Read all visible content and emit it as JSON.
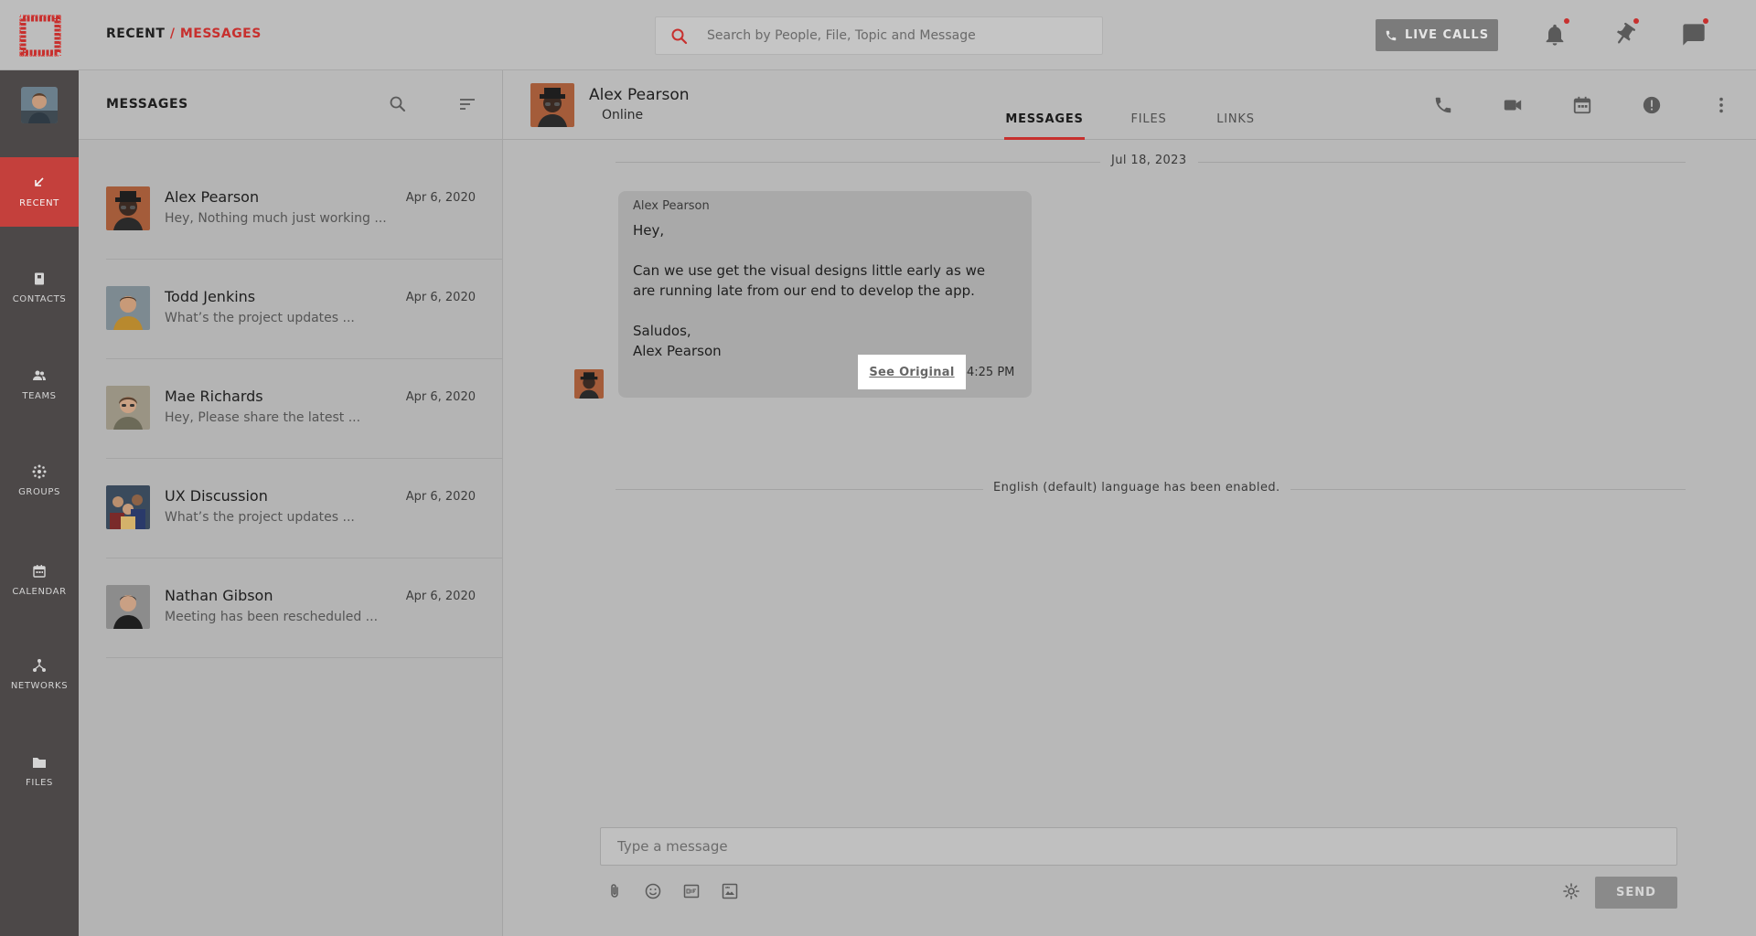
{
  "breadcrumb": {
    "root": "RECENT",
    "separator": "/",
    "current": "MESSAGES"
  },
  "search": {
    "placeholder": "Search by People, File, Topic and Message"
  },
  "header_actions": {
    "live_calls_label": "LIVE CALLS"
  },
  "icons": {
    "logo": "brand-logo",
    "search": "search-icon",
    "phone": "phone-icon",
    "bell": "bell-icon",
    "pin": "pin-icon",
    "chat": "chat-icon",
    "filter": "sort-icon"
  },
  "colors": {
    "accent": "#c7302e",
    "nav_bg": "#4c4848",
    "nav_active": "#c4403c"
  },
  "nav": {
    "items": [
      {
        "label": "RECENT",
        "icon": "arrow-down-left-icon",
        "active": true
      },
      {
        "label": "CONTACTS",
        "icon": "contact-book-icon"
      },
      {
        "label": "TEAMS",
        "icon": "people-icon"
      },
      {
        "label": "GROUPS",
        "icon": "group-icon"
      },
      {
        "label": "CALENDAR",
        "icon": "calendar-icon"
      },
      {
        "label": "NETWORKS",
        "icon": "network-icon"
      },
      {
        "label": "FILES",
        "icon": "folder-icon"
      }
    ]
  },
  "list": {
    "title": "MESSAGES",
    "conversations": [
      {
        "name": "Alex Pearson",
        "date": "Apr 6, 2020",
        "preview": "Hey, Nothing much just working ..."
      },
      {
        "name": "Todd Jenkins",
        "date": "Apr 6, 2020",
        "preview": "What’s the project updates ..."
      },
      {
        "name": "Mae Richards",
        "date": "Apr 6, 2020",
        "preview": "Hey, Please share the latest ..."
      },
      {
        "name": "UX Discussion",
        "date": "Apr 6, 2020",
        "preview": "What’s the project updates ..."
      },
      {
        "name": "Nathan Gibson",
        "date": "Apr 6, 2020",
        "preview": "Meeting has been rescheduled ..."
      }
    ]
  },
  "chat": {
    "contact_name": "Alex Pearson",
    "status": "Online",
    "tabs": [
      "MESSAGES",
      "FILES",
      "LINKS"
    ],
    "active_tab": "MESSAGES",
    "date_divider": "Jul 18, 2023",
    "message": {
      "sender": "Alex Pearson",
      "lines": [
        "Hey,",
        "",
        "Can we use get the visual designs little early as we",
        "are running late from our end to develop the app.",
        "",
        "Saludos,",
        "Alex Pearson"
      ],
      "see_original_label": "See Original",
      "time": "4:25 PM"
    },
    "system_notice": "English (default) language has been enabled.",
    "composer": {
      "placeholder": "Type a message",
      "send_label": "SEND"
    }
  }
}
